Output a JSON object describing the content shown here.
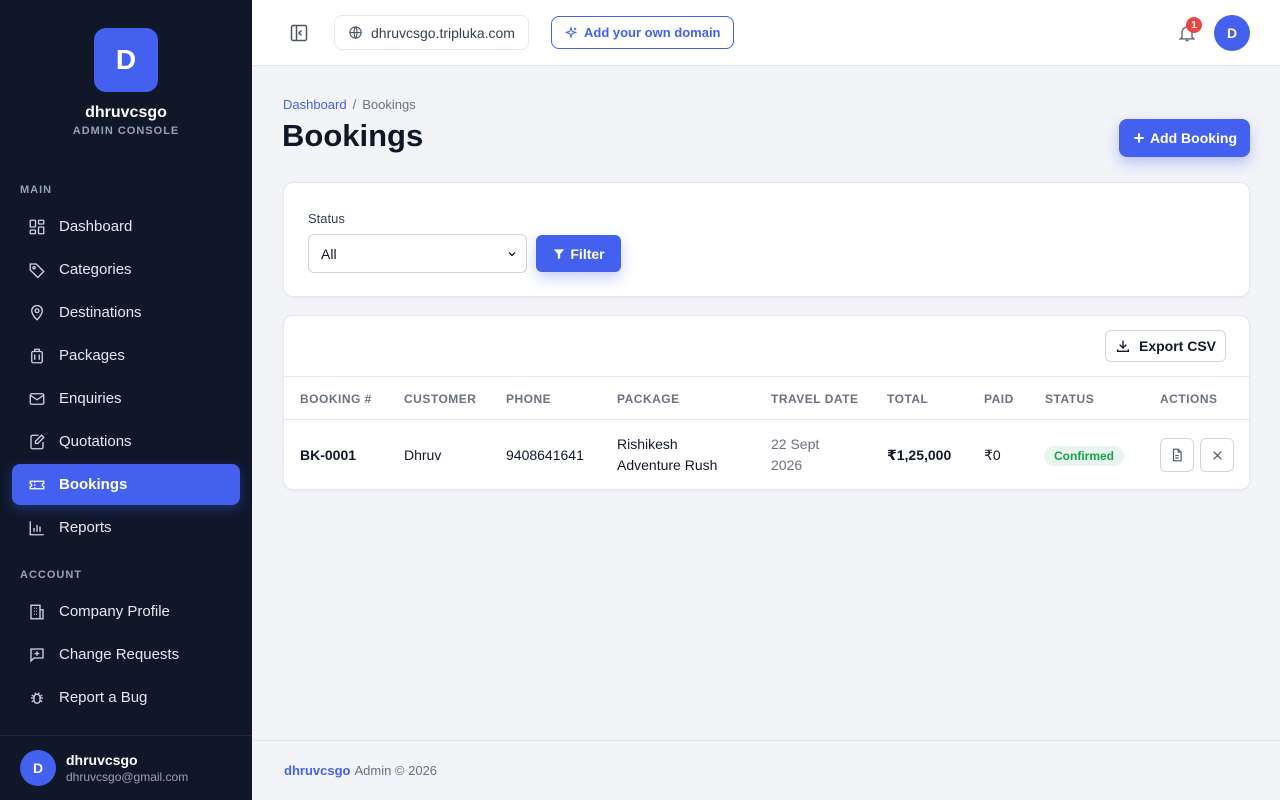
{
  "brand": {
    "initial": "D",
    "name": "dhruvcsgo",
    "subtitle": "ADMIN CONSOLE"
  },
  "sidebar": {
    "main_label": "MAIN",
    "main_items": [
      {
        "label": "Dashboard",
        "icon": "grid-icon"
      },
      {
        "label": "Categories",
        "icon": "tag-icon"
      },
      {
        "label": "Destinations",
        "icon": "map-pin-icon"
      },
      {
        "label": "Packages",
        "icon": "luggage-icon"
      },
      {
        "label": "Enquiries",
        "icon": "mail-icon"
      },
      {
        "label": "Quotations",
        "icon": "edit-document-icon"
      },
      {
        "label": "Bookings",
        "icon": "ticket-icon",
        "active": true
      },
      {
        "label": "Reports",
        "icon": "bar-chart-icon"
      }
    ],
    "account_label": "ACCOUNT",
    "account_items": [
      {
        "label": "Company Profile",
        "icon": "building-icon"
      },
      {
        "label": "Change Requests",
        "icon": "message-plus-icon"
      },
      {
        "label": "Report a Bug",
        "icon": "bug-icon"
      }
    ],
    "user": {
      "initial": "D",
      "name": "dhruvcsgo",
      "email": "dhruvcsgo@gmail.com"
    }
  },
  "topbar": {
    "domain": "dhruvcsgo.tripluka.com",
    "add_domain_label": "Add your own domain",
    "notification_count": "1",
    "avatar_initial": "D"
  },
  "breadcrumb": {
    "home": "Dashboard",
    "separator": "/",
    "current": "Bookings"
  },
  "page": {
    "title": "Bookings",
    "add_button": "Add Booking"
  },
  "filter": {
    "label": "Status",
    "selected": "All",
    "button": "Filter"
  },
  "table": {
    "export_label": "Export CSV",
    "columns": [
      "BOOKING #",
      "CUSTOMER",
      "PHONE",
      "PACKAGE",
      "TRAVEL DATE",
      "TOTAL",
      "PAID",
      "STATUS",
      "ACTIONS"
    ],
    "rows": [
      {
        "booking": "BK-0001",
        "customer": "Dhruv",
        "phone": "9408641641",
        "package_line1": "Rishikesh",
        "package_line2": "Adventure Rush",
        "date_line1": "22 Sept",
        "date_line2": "2026",
        "total": "₹1,25,000",
        "paid": "₹0",
        "status": "Confirmed"
      }
    ]
  },
  "footer": {
    "brand": "dhruvcsgo",
    "text": "Admin © 2026"
  },
  "colors": {
    "accent": "#4361ee",
    "sidebar_bg": "#0f1729",
    "success": "#16a34a",
    "danger": "#ef4444"
  }
}
